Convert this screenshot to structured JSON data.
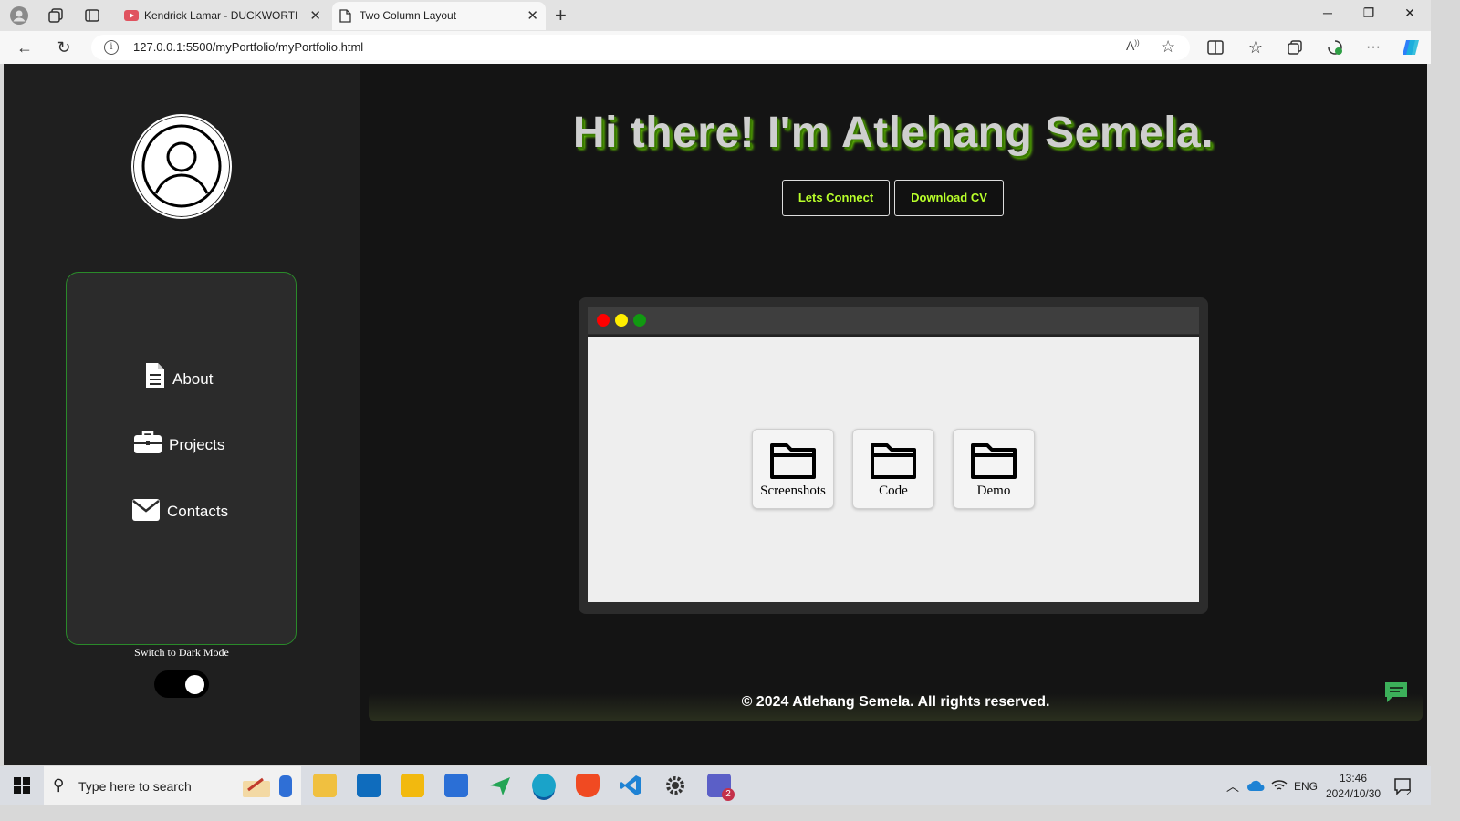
{
  "browser": {
    "tabs": [
      {
        "label": "Kendrick Lamar - DUCKWORTH. (",
        "active": false
      },
      {
        "label": "Two Column Layout",
        "active": true
      }
    ],
    "url": "127.0.0.1:5500/myPortfolio/myPortfolio.html"
  },
  "page": {
    "headline": "Hi there! I'm Atlehang Semela.",
    "buttons": {
      "connect": "Lets Connect",
      "download_cv": "Download CV"
    },
    "nav": [
      {
        "label": "About",
        "icon": "document-icon"
      },
      {
        "label": "Projects",
        "icon": "briefcase-icon"
      },
      {
        "label": "Contacts",
        "icon": "envelope-icon"
      }
    ],
    "dark_mode_label": "Switch to Dark Mode",
    "dark_mode_on": true,
    "folders": [
      "Screenshots",
      "Code",
      "Demo"
    ],
    "footer": "© 2024 Atlehang Semela. All rights reserved.",
    "colors": {
      "accent": "#b8ff2a",
      "nav_border": "#2a8a2a"
    }
  },
  "taskbar": {
    "search_placeholder": "Type here to search",
    "language": "ENG",
    "time": "13:46",
    "date": "2024/10/30",
    "teams_badge": "2",
    "notification_badge": "2"
  }
}
